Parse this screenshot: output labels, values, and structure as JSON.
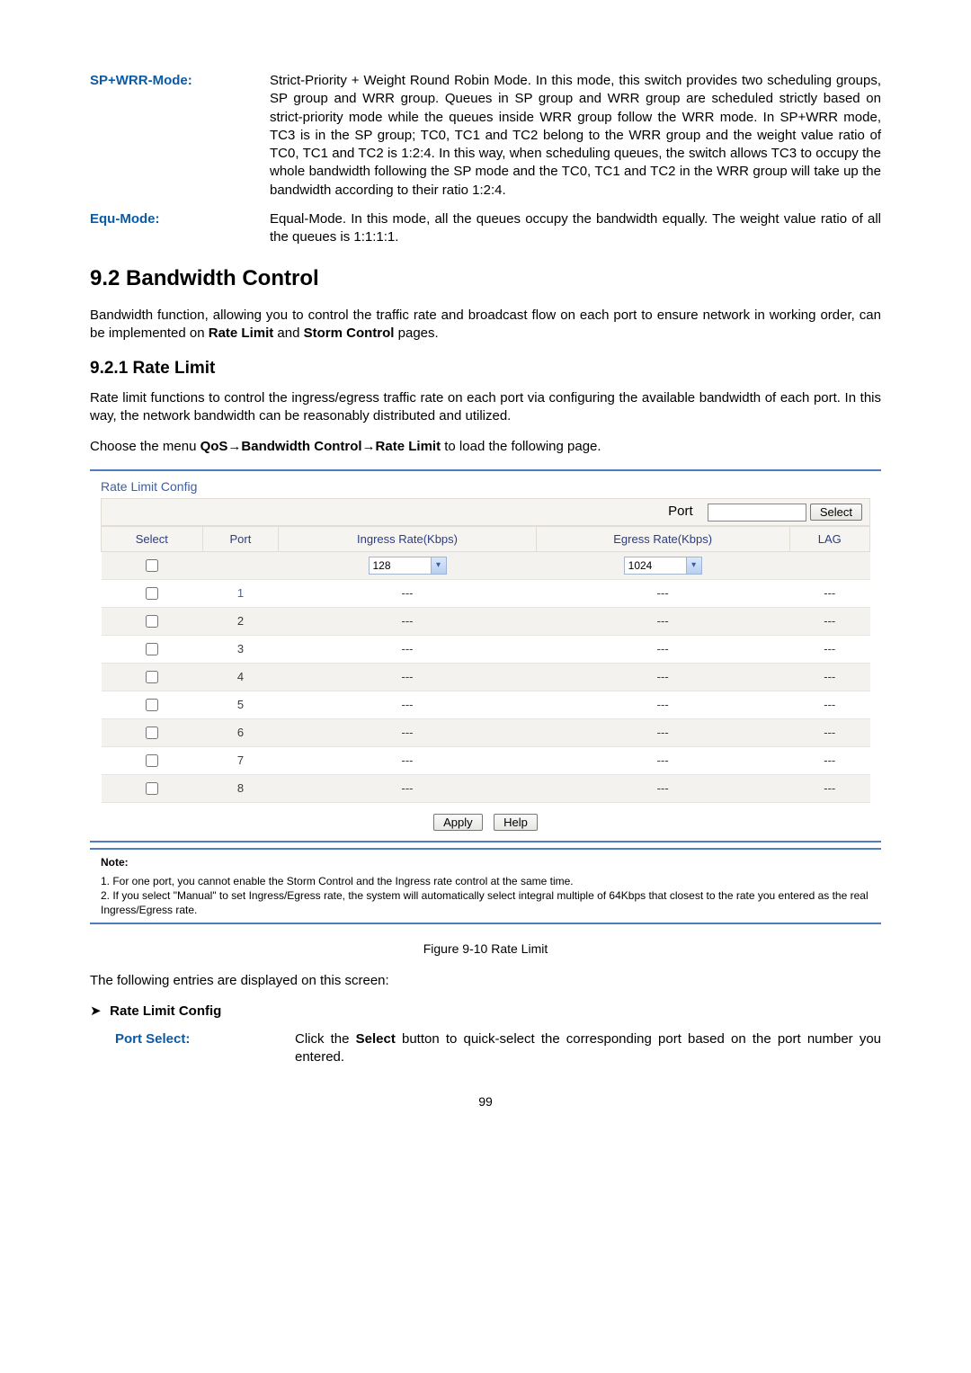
{
  "defs": [
    {
      "label": "SP+WRR-Mode:",
      "body": "Strict-Priority + Weight Round Robin Mode. In this mode, this switch provides two scheduling groups, SP group and WRR group. Queues in SP group and WRR group are scheduled strictly based on strict-priority mode while the queues inside WRR group follow the WRR mode. In SP+WRR mode, TC3 is in the SP group; TC0, TC1 and TC2 belong to the WRR group and the weight value ratio of TC0, TC1 and TC2 is 1:2:4. In this way, when scheduling queues, the switch allows TC3 to occupy the whole bandwidth following the SP mode and the TC0, TC1 and TC2 in the WRR group will take up the bandwidth according to their ratio 1:2:4."
    },
    {
      "label": "Equ-Mode:",
      "body": "Equal-Mode. In this mode, all the queues occupy the bandwidth equally. The weight value ratio of all the queues is 1:1:1:1."
    }
  ],
  "section_heading": "9.2   Bandwidth Control",
  "bw_p1a": "Bandwidth function, allowing you to control the traffic rate and broadcast flow on each port to ensure network in working order, can be implemented on ",
  "bw_p1b": "Rate Limit",
  "bw_p1c": " and ",
  "bw_p1d": "Storm Control",
  "bw_p1e": " pages.",
  "sub_heading": "9.2.1 Rate Limit",
  "rl_par": "Rate limit functions to control the ingress/egress traffic rate on each port via configuring the available bandwidth of each port. In this way, the network bandwidth can be reasonably distributed and utilized.",
  "menu_line_a": "Choose the menu ",
  "menu_line_b": "QoS→Bandwidth Control→Rate Limit",
  "menu_line_c": " to load the following page.",
  "fig": {
    "title": "Rate Limit Config",
    "port_label": "Port",
    "port_input": "",
    "select_btn": "Select",
    "cols": [
      "Select",
      "Port",
      "Ingress Rate(Kbps)",
      "Egress Rate(Kbps)",
      "LAG"
    ],
    "ingress_val": "128",
    "egress_val": "1024",
    "rows": [
      {
        "port": "1",
        "ingress": "---",
        "egress": "---",
        "lag": "---"
      },
      {
        "port": "2",
        "ingress": "---",
        "egress": "---",
        "lag": "---"
      },
      {
        "port": "3",
        "ingress": "---",
        "egress": "---",
        "lag": "---"
      },
      {
        "port": "4",
        "ingress": "---",
        "egress": "---",
        "lag": "---"
      },
      {
        "port": "5",
        "ingress": "---",
        "egress": "---",
        "lag": "---"
      },
      {
        "port": "6",
        "ingress": "---",
        "egress": "---",
        "lag": "---"
      },
      {
        "port": "7",
        "ingress": "---",
        "egress": "---",
        "lag": "---"
      },
      {
        "port": "8",
        "ingress": "---",
        "egress": "---",
        "lag": "---"
      }
    ],
    "apply_btn": "Apply",
    "help_btn": "Help",
    "note_title": "Note:",
    "note1": "1. For one port, you cannot enable the Storm Control and the Ingress rate control at the same time.",
    "note2": "2. If you select \"Manual\" to set Ingress/Egress rate, the system will automatically select integral multiple of 64Kbps that closest to the rate you entered as the real Ingress/Egress rate."
  },
  "fig_caption": "Figure 9-10 Rate Limit",
  "entries_line": "The following entries are displayed on this screen:",
  "bullet_label": "Rate Limit Config",
  "portsel": {
    "label": "Port Select:",
    "body_a": "Click the ",
    "body_b": "Select",
    "body_c": " button to quick-select the corresponding port based on the port number you entered."
  },
  "page_number": "99"
}
